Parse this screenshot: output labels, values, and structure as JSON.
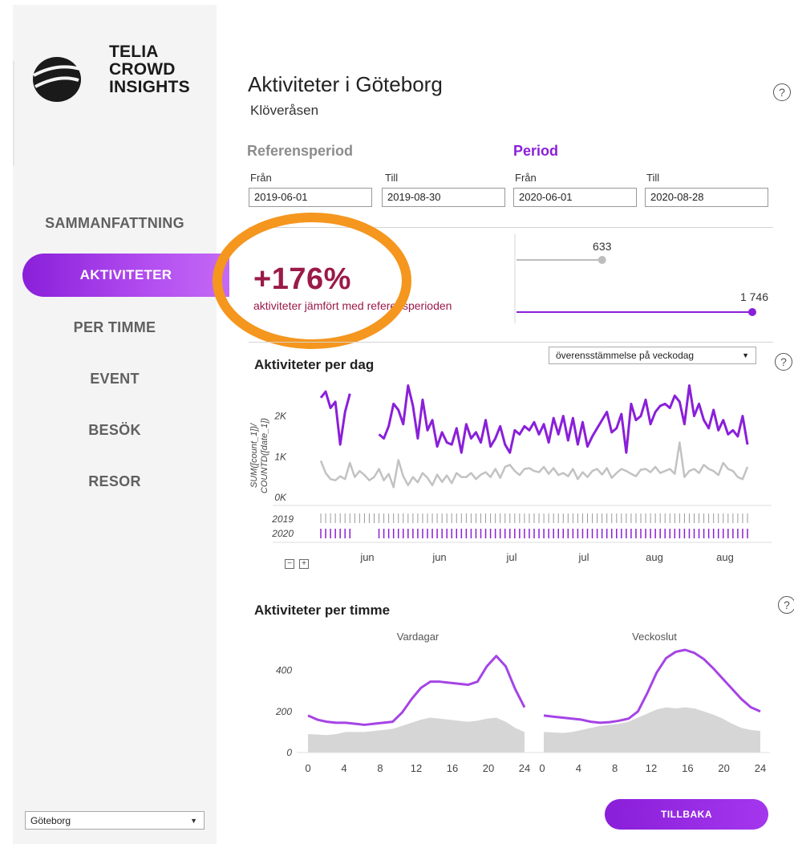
{
  "brand": {
    "line1": "TELIA",
    "line2": "CROWD",
    "line3": "INSIGHTS"
  },
  "nav": {
    "items": [
      {
        "label": "SAMMANFATTNING"
      },
      {
        "label": "AKTIVITETER"
      },
      {
        "label": "PER TIMME"
      },
      {
        "label": "EVENT"
      },
      {
        "label": "BESÖK"
      },
      {
        "label": "RESOR"
      }
    ],
    "active_index": 1
  },
  "city_select": {
    "value": "Göteborg"
  },
  "header": {
    "title": "Aktiviteter i Göteborg",
    "subtitle": "Klöveråsen",
    "help": "?"
  },
  "reference": {
    "heading": "Referensperiod",
    "from_label": "Från",
    "to_label": "Till",
    "from": "2019-06-01",
    "to": "2019-08-30"
  },
  "period": {
    "heading": "Period",
    "from_label": "Från",
    "to_label": "Till",
    "from": "2020-06-01",
    "to": "2020-08-28"
  },
  "summary": {
    "percent": "+176%",
    "description": "aktiviteter jämfört med referensperioden",
    "reference_value": "633",
    "period_value": "1 746",
    "reference_fraction": 0.363,
    "period_fraction": 1.0
  },
  "per_day": {
    "title": "Aktiviteter per dag",
    "dropdown": "överensstämmelse på veckodag",
    "ylabel_line1": "SUM([count_1])/",
    "ylabel_line2": "COUNTD([date_1])",
    "yticks": [
      "2K",
      "1K",
      "0K"
    ],
    "row_labels": [
      "2019",
      "2020"
    ],
    "months": [
      "jun",
      "jun",
      "jul",
      "jul",
      "aug",
      "aug"
    ],
    "zoom_minus": "−",
    "zoom_plus": "+"
  },
  "per_hour": {
    "title": "Aktiviteter per timme",
    "panels": [
      "Vardagar",
      "Veckoslut"
    ],
    "yticks": [
      "400",
      "200",
      "0"
    ],
    "xticks_left": [
      "0",
      "4",
      "8",
      "12",
      "16",
      "20",
      "24"
    ],
    "xticks_right": [
      "0",
      "4",
      "8",
      "12",
      "16",
      "20",
      "24"
    ]
  },
  "back_button": "TILLBAKA",
  "colors": {
    "accent": "#9b30e0",
    "negative_text": "#9a1a48",
    "highlight_ring": "#f5961e",
    "ref_grey": "#bdbdbd"
  },
  "chart_data": [
    {
      "type": "line",
      "title": "Aktiviteter per dag",
      "ylabel": "SUM([count_1])/COUNTD([date_1])",
      "ylim": [
        0,
        2800
      ],
      "series": [
        {
          "name": "2020",
          "values": [
            2450,
            2600,
            2200,
            2350,
            1300,
            2100,
            2550,
            2300,
            2200,
            2050,
            2250,
            1900,
            1550,
            1450,
            1750,
            2300,
            2150,
            1800,
            2750,
            2250,
            1450,
            2400,
            1650,
            1900,
            1250,
            1600,
            1350,
            1300,
            1700,
            1100,
            1800,
            1450,
            1600,
            1350,
            1900,
            1250,
            1450,
            1750,
            1300,
            1100,
            1650,
            1550,
            1750,
            1650,
            1850,
            1550,
            1800,
            1350,
            1950,
            1550,
            2000,
            1400,
            1950,
            1300,
            1850,
            1250,
            1500,
            1700,
            1900,
            2100,
            1600,
            1700,
            2050,
            1100,
            2300,
            1900,
            2000,
            2400,
            1800,
            2100,
            2250,
            2300,
            2200,
            2500,
            2350,
            1800,
            2750,
            2000,
            2300,
            1900,
            1700,
            2150,
            1650,
            1900,
            1550,
            1650,
            1500,
            2000,
            1300
          ]
        },
        {
          "name": "2019",
          "values": [
            900,
            600,
            450,
            420,
            520,
            450,
            850,
            500,
            650,
            550,
            420,
            500,
            700,
            420,
            580,
            250,
            920,
            520,
            300,
            500,
            370,
            600,
            480,
            300,
            560,
            380,
            540,
            350,
            600,
            500,
            500,
            600,
            450,
            560,
            620,
            500,
            700,
            480,
            750,
            800,
            650,
            550,
            700,
            720,
            650,
            620,
            750,
            580,
            720,
            550,
            600,
            520,
            700,
            450,
            620,
            500,
            650,
            700,
            560,
            720,
            480,
            600,
            700,
            650,
            580,
            520,
            680,
            700,
            620,
            750,
            600,
            650,
            700,
            580,
            1350,
            500,
            650,
            700,
            600,
            800,
            700,
            650,
            550,
            850,
            700,
            650,
            500,
            450,
            750
          ]
        }
      ]
    },
    {
      "type": "line",
      "title": "Vardagar",
      "x": [
        0,
        1,
        2,
        3,
        4,
        5,
        6,
        7,
        8,
        9,
        10,
        11,
        12,
        13,
        14,
        15,
        16,
        17,
        18,
        19,
        20,
        21,
        22,
        23
      ],
      "ylim": [
        0,
        500
      ],
      "series": [
        {
          "name": "2020",
          "values": [
            180,
            160,
            150,
            145,
            145,
            140,
            135,
            140,
            145,
            150,
            195,
            260,
            315,
            345,
            345,
            340,
            335,
            330,
            345,
            420,
            470,
            420,
            310,
            220
          ]
        },
        {
          "name": "2019",
          "values": [
            90,
            88,
            85,
            90,
            100,
            100,
            100,
            105,
            110,
            115,
            130,
            145,
            160,
            170,
            165,
            160,
            155,
            150,
            155,
            165,
            170,
            150,
            120,
            100
          ]
        }
      ]
    },
    {
      "type": "line",
      "title": "Veckoslut",
      "x": [
        0,
        1,
        2,
        3,
        4,
        5,
        6,
        7,
        8,
        9,
        10,
        11,
        12,
        13,
        14,
        15,
        16,
        17,
        18,
        19,
        20,
        21,
        22,
        23
      ],
      "ylim": [
        0,
        500
      ],
      "series": [
        {
          "name": "2020",
          "values": [
            180,
            175,
            170,
            165,
            160,
            150,
            145,
            148,
            155,
            165,
            200,
            290,
            390,
            460,
            490,
            500,
            485,
            455,
            410,
            360,
            310,
            260,
            220,
            200
          ]
        },
        {
          "name": "2019",
          "values": [
            100,
            98,
            95,
            100,
            110,
            120,
            130,
            135,
            140,
            150,
            170,
            190,
            210,
            220,
            215,
            220,
            215,
            200,
            185,
            165,
            140,
            120,
            110,
            105
          ]
        }
      ]
    }
  ]
}
